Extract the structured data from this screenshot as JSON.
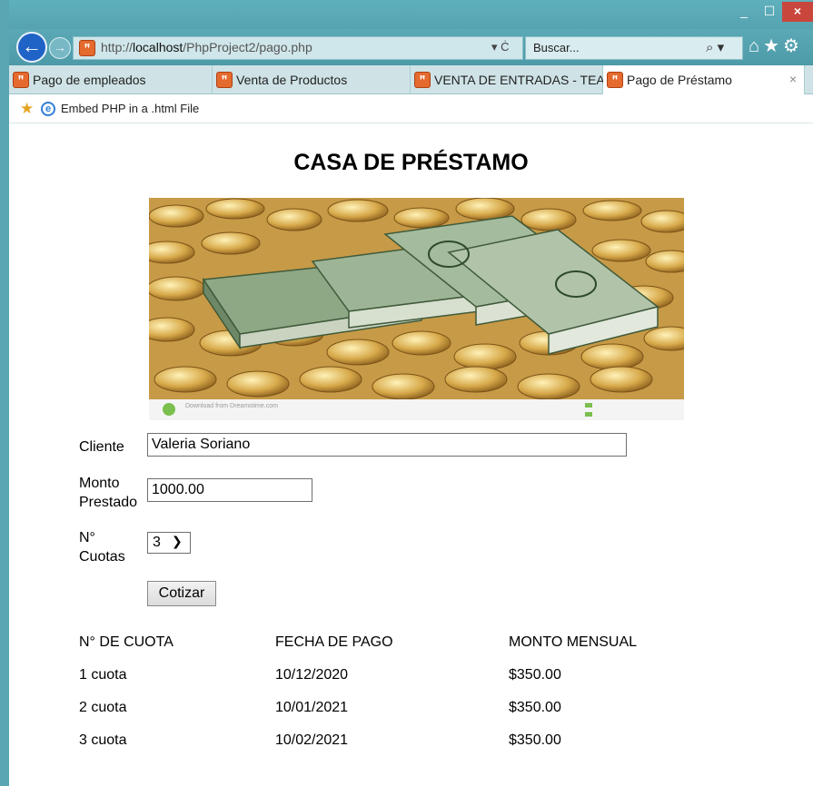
{
  "browser": {
    "window_controls": {
      "minimize": "_",
      "maximize": "☐",
      "close": "×"
    },
    "back_symbol": "←",
    "forward_symbol": "→",
    "address": {
      "prefix": "http://",
      "host": "localhost",
      "path": "/PhpProject2/pago.php"
    },
    "address_controls": "▾ Ċ",
    "search": {
      "placeholder": "Buscar...",
      "icon": "search-icon",
      "dropdown": "▾"
    },
    "nav_icons": "⌂★⚙",
    "tabs": [
      {
        "label": "Pago de empleados",
        "active": false
      },
      {
        "label": "Venta de Productos",
        "active": false
      },
      {
        "label": "VENTA DE ENTRADAS - TEA...",
        "active": false
      },
      {
        "label": "Pago de Préstamo",
        "active": true
      }
    ],
    "tab_close": "×",
    "favorites": {
      "label": "Embed PHP in a .html File"
    }
  },
  "page": {
    "title": "CASA DE PRÉSTAMO",
    "banner": {
      "caption": "Download from Dreamstime.com"
    },
    "form": {
      "cliente_label": "Cliente",
      "cliente_value": "Valeria Soriano",
      "monto_label_1": "Monto",
      "monto_label_2": "Prestado",
      "monto_value": "1000.00",
      "cuotas_label_1": "N°",
      "cuotas_label_2": "Cuotas",
      "cuotas_value": "3",
      "cotizar_label": "Cotizar"
    },
    "table": {
      "headers": [
        "N° DE CUOTA",
        "FECHA DE PAGO",
        "MONTO MENSUAL"
      ],
      "rows": [
        [
          "1 cuota",
          "10/12/2020",
          "$350.00"
        ],
        [
          "2 cuota",
          "10/01/2021",
          "$350.00"
        ],
        [
          "3 cuota",
          "10/02/2021",
          "$350.00"
        ]
      ]
    }
  },
  "colors": {
    "chrome": "#5aa6b3",
    "tab_bar": "#cfe3e6",
    "close_button": "#c9463d",
    "back_button": "#1f63c6"
  }
}
